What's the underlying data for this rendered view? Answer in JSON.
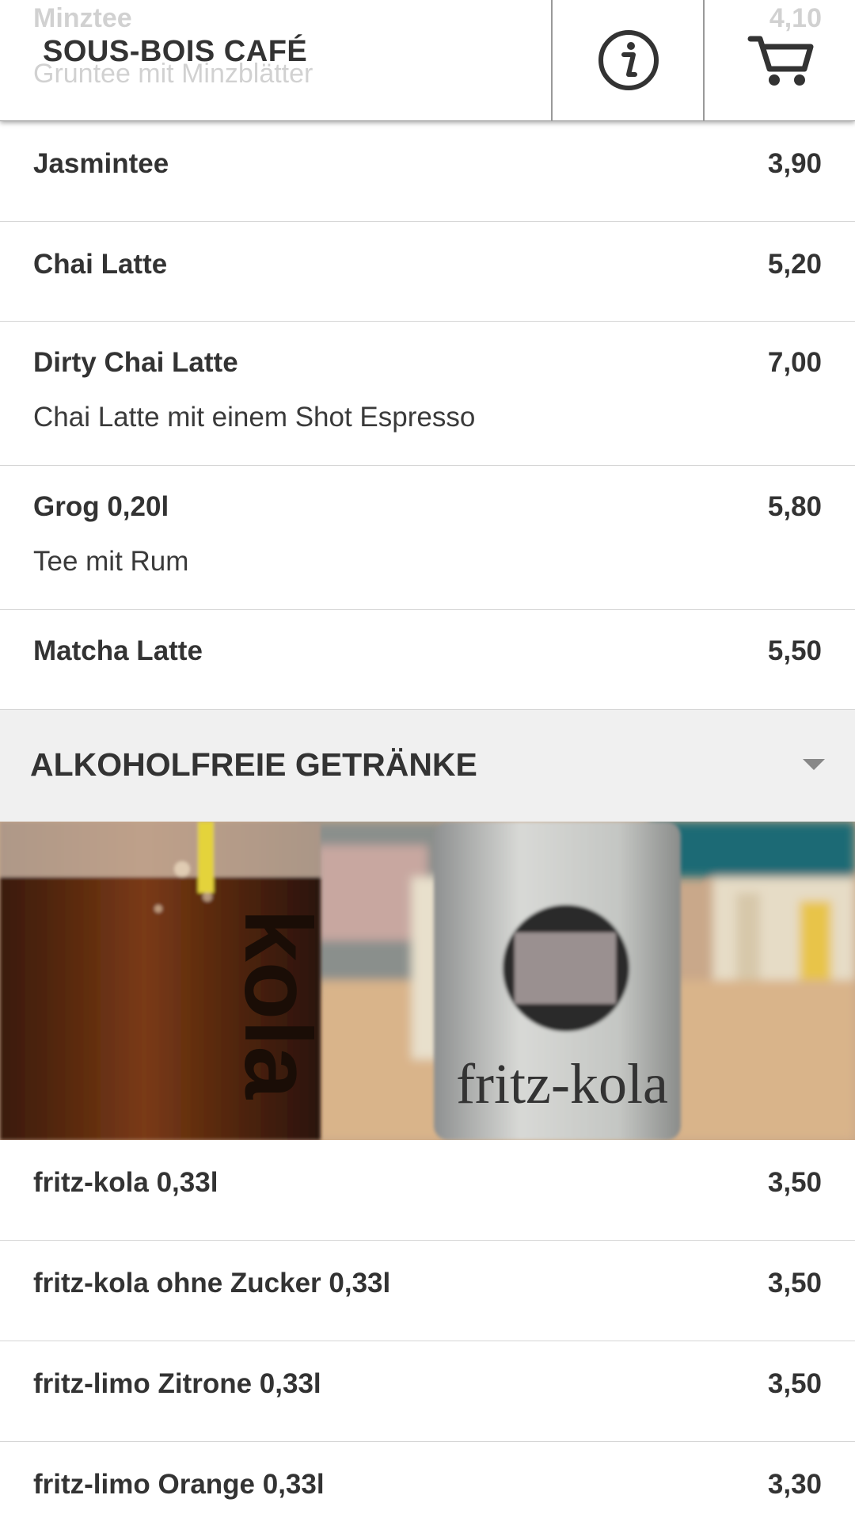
{
  "header": {
    "title": "SOUS-BOIS CAFÉ",
    "ghost_item": {
      "name": "Minztee",
      "description": "Gruntee mit Minzblätter",
      "price": "4,10"
    },
    "info_icon": "info-icon",
    "cart_icon": "cart-icon"
  },
  "tea_items": [
    {
      "name": "Jasmintee",
      "price": "3,90",
      "description": ""
    },
    {
      "name": "Chai Latte",
      "price": "5,20",
      "description": ""
    },
    {
      "name": "Dirty Chai Latte",
      "price": "7,00",
      "description": "Chai Latte mit einem Shot Espresso"
    },
    {
      "name": "Grog 0,20l",
      "price": "5,80",
      "description": "Tee mit Rum"
    },
    {
      "name": "Matcha Latte",
      "price": "5,50",
      "description": ""
    }
  ],
  "section": {
    "title": "ALKOHOLFREIE GETRÄNKE",
    "caret_icon": "caret-down-icon",
    "photo_text": {
      "glass_label": "kola",
      "bottle_label": "fritz-kola"
    }
  },
  "soft_drinks": [
    {
      "name": "fritz-kola 0,33l",
      "price": "3,50"
    },
    {
      "name": "fritz-kola ohne Zucker 0,33l",
      "price": "3,50"
    },
    {
      "name": "fritz-limo Zitrone 0,33l",
      "price": "3,50"
    },
    {
      "name": "fritz-limo Orange 0,33l",
      "price": "3,30"
    }
  ],
  "colors": {
    "text": "#333333",
    "divider": "#d6d6d6",
    "section_bg": "#f0f0f0",
    "caret": "#888888"
  }
}
